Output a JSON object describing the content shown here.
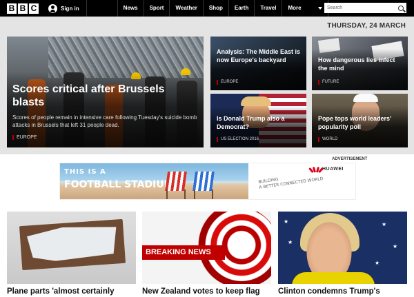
{
  "header": {
    "logo": [
      "B",
      "B",
      "C"
    ],
    "sign_in": "Sign in",
    "nav": [
      "News",
      "Sport",
      "Weather",
      "Shop",
      "Earth",
      "Travel"
    ],
    "more_label": "More",
    "search_placeholder": "Search"
  },
  "date": "THURSDAY, 24 MARCH",
  "hero": {
    "title": "Scores critical after Brussels blasts",
    "summary": "Scores of people remain in intensive care following Tuesday's suicide bomb attacks in Brussels that left 31 people dead.",
    "tag": "EUROPE"
  },
  "tiles": [
    {
      "title": "Analysis: The Middle East is now Europe's backyard",
      "tag": "EUROPE"
    },
    {
      "title": "How dangerous lies infect the mind",
      "tag": "FUTURE"
    },
    {
      "title": "Is Donald Trump also a Democrat?",
      "tag": "US ELECTION 2016"
    },
    {
      "title": "Pope tops world leaders' popularity poll",
      "tag": "WORLD"
    }
  ],
  "ad": {
    "label": "ADVERTISEMENT",
    "headline_1": "THIS IS A",
    "headline_2": "FOOTBALL STADIUM",
    "slogan_1": "BUILDING",
    "slogan_2": "A BETTER CONNECTED WORLD",
    "brand": "HUAWEI"
  },
  "cards": [
    {
      "title": "Plane parts 'almost certainly"
    },
    {
      "title": "New Zealand votes to keep flag",
      "overlay": "BREAKING NEWS"
    },
    {
      "title": "Clinton condemns Trump's"
    }
  ],
  "colors": {
    "bbc_black": "#000000",
    "tag_red": "#b80000",
    "breaking_red": "#c00000",
    "band_grey": "#e4e4e4"
  }
}
